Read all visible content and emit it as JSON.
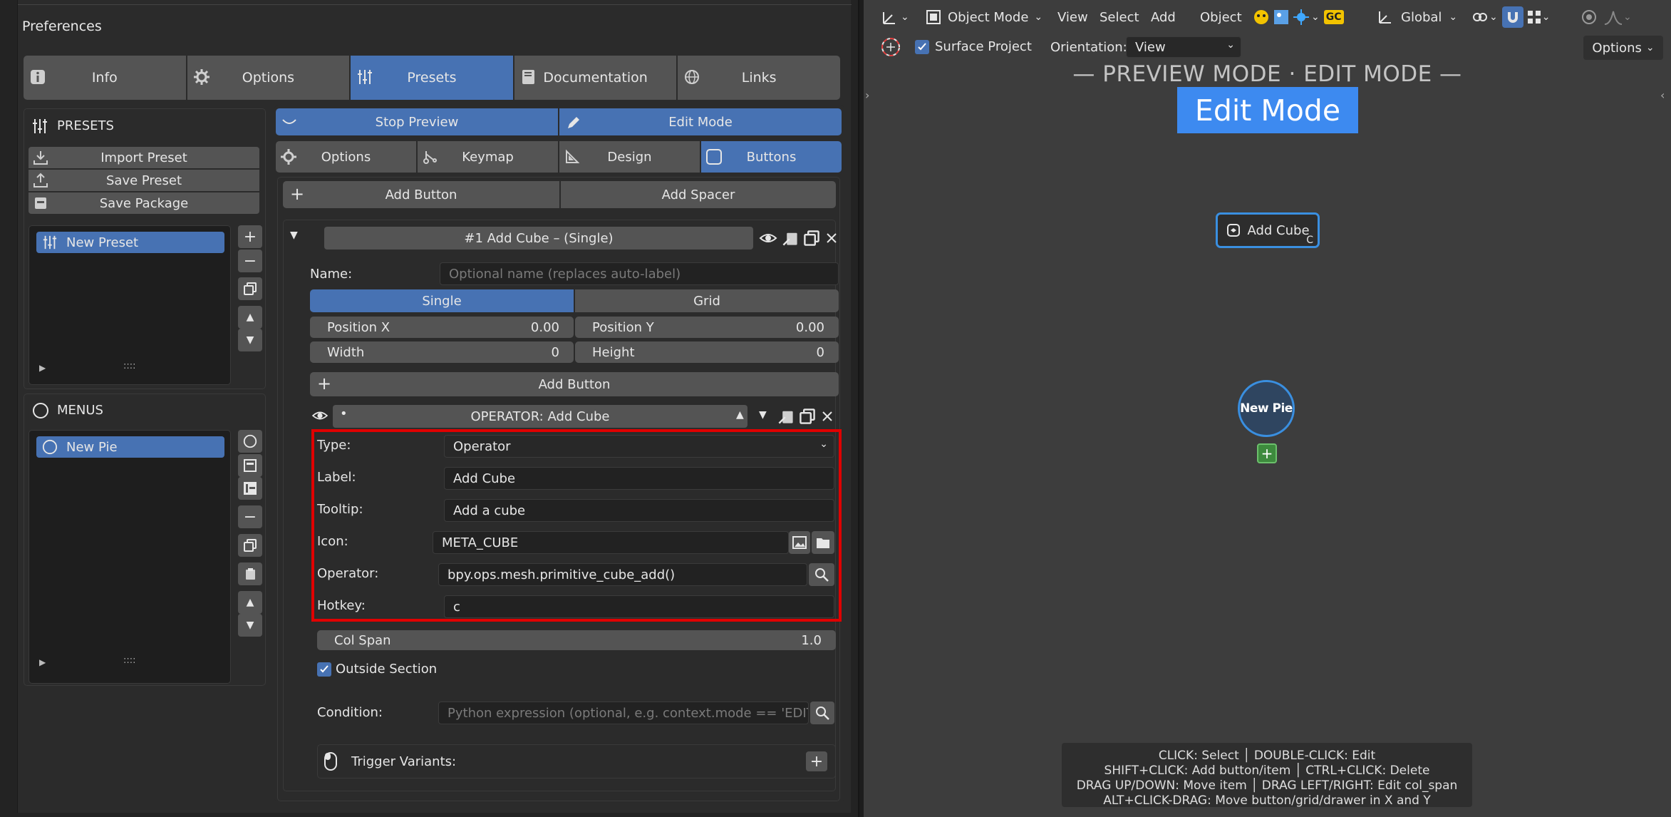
{
  "window_title": "Preferences",
  "main_tabs": [
    {
      "label": "Info",
      "icon": "info-icon"
    },
    {
      "label": "Options",
      "icon": "gear-icon"
    },
    {
      "label": "Presets",
      "icon": "sliders-icon",
      "active": true
    },
    {
      "label": "Documentation",
      "icon": "book-icon"
    },
    {
      "label": "Links",
      "icon": "globe-icon"
    }
  ],
  "presets_panel": {
    "title": "PRESETS",
    "import": "Import Preset",
    "save": "Save Preset",
    "package": "Save Package",
    "items": [
      "New Preset"
    ],
    "grip": "::::"
  },
  "menus_panel": {
    "title": "MENUS",
    "items": [
      "New Pie"
    ],
    "grip": "::::"
  },
  "top_buttons": {
    "stop_preview": "Stop Preview",
    "edit_mode": "Edit Mode"
  },
  "sub_tabs": [
    "Options",
    "Keymap",
    "Design",
    "Buttons"
  ],
  "add_buttons": {
    "add_button": "Add Button",
    "add_spacer": "Add Spacer"
  },
  "button_header": "#1  Add Cube – (Single)",
  "name_field": {
    "label": "Name:",
    "placeholder": "Optional name (replaces auto-label)"
  },
  "layout_toggle": {
    "single": "Single",
    "grid": "Grid"
  },
  "position": {
    "x_label": "Position X",
    "x_value": "0.00",
    "y_label": "Position Y",
    "y_value": "0.00"
  },
  "size": {
    "width_label": "Width",
    "width_value": "0",
    "height_label": "Height",
    "height_value": "0"
  },
  "inner_add_button": "Add Button",
  "operator_header": "OPERATOR: Add Cube",
  "form": {
    "type_label": "Type:",
    "type_value": "Operator",
    "label_label": "Label:",
    "label_value": "Add Cube",
    "tooltip_label": "Tooltip:",
    "tooltip_value": "Add a cube",
    "icon_label": "Icon:",
    "icon_value": "META_CUBE",
    "operator_label": "Operator:",
    "operator_value": "bpy.ops.mesh.primitive_cube_add()",
    "hotkey_label": "Hotkey:",
    "hotkey_value": "c"
  },
  "col_span": {
    "label": "Col Span",
    "value": "1.0"
  },
  "outside_section": "Outside Section",
  "condition": {
    "label": "Condition:",
    "placeholder": "Python expression (optional, e.g. context.mode == 'EDIT_ME"
  },
  "trigger_variants": "Trigger Variants:",
  "viewport": {
    "mode": "Object Mode",
    "menus": [
      "View",
      "Select",
      "Add",
      "Object"
    ],
    "gc": "GC",
    "transform": "Global",
    "surface_project": "Surface Project",
    "orientation_label": "Orientation:",
    "orientation_value": "View",
    "options": "Options",
    "banner": "— PREVIEW MODE  ·  EDIT MODE —",
    "edit_badge": "Edit Mode",
    "cube_button": "Add Cube",
    "cube_hotkey": "C",
    "pie_label": "New Pie",
    "help_lines": [
      "CLICK: Select  │  DOUBLE-CLICK: Edit",
      "SHIFT+CLICK: Add button/item  │  CTRL+CLICK: Delete",
      "DRAG UP/DOWN: Move item  │  DRAG LEFT/RIGHT: Edit col_span",
      "ALT+CLICK-DRAG: Move button/grid/drawer in X and Y"
    ]
  },
  "colors": {
    "accent": "#4772b3",
    "highlight_border": "#e00000",
    "add_green": "#3d8a3d"
  }
}
